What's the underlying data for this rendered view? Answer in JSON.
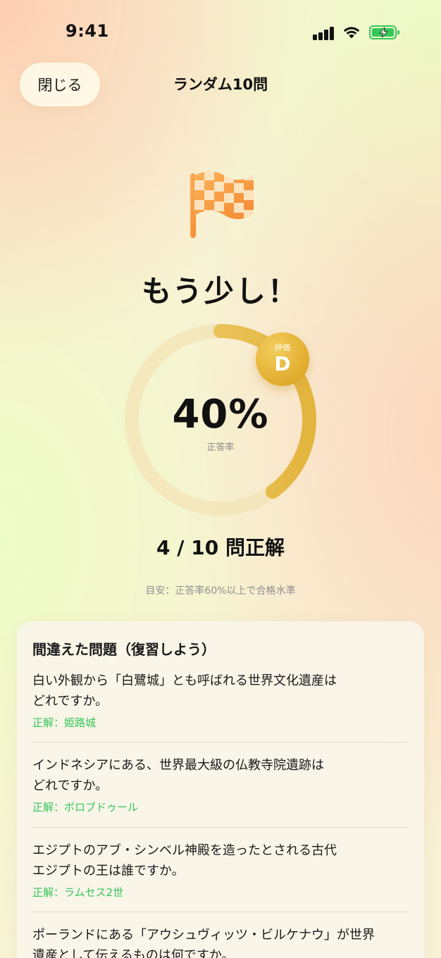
{
  "status_bar": {
    "time": "9:41"
  },
  "header": {
    "close_label": "閉じる",
    "title": "ランダム10問"
  },
  "result": {
    "headline": "もう少し！",
    "percent": "40%",
    "percent_label": "正答率",
    "accuracy_fraction": 0.4,
    "grade_label": "評価",
    "grade": "D",
    "score_text": "4 / 10 問正解",
    "hint": "目安：正答率60%以上で合格水準"
  },
  "wrong_questions": {
    "title": "間違えた問題（復習しよう）",
    "items": [
      {
        "line1": "白い外観から「白鷺城」とも呼ばれる世界文化遺産は",
        "line2": "どれですか。",
        "answer": "正解：姫路城"
      },
      {
        "line1": "インドネシアにある、世界最大級の仏教寺院遺跡は",
        "line2": "どれですか。",
        "answer": "正解：ボロブドゥール"
      },
      {
        "line1": "エジプトのアブ・シンベル神殿を造ったとされる古代",
        "line2": "エジプトの王は誰ですか。",
        "answer": "正解：ラムセス2世"
      },
      {
        "line1": "ポーランドにある「アウシュヴィッツ・ビルケナウ」が世界",
        "line2": "遺産として伝えるものは何ですか。"
      }
    ]
  },
  "colors": {
    "accent_gold": "#e8b73a",
    "ring_track": "#f3e3b0",
    "correct_green": "#34c759",
    "flag_orange": "#f7923a"
  },
  "icons": [
    "signal-icon",
    "wifi-icon",
    "battery-charging-icon",
    "checkered-flag-icon"
  ]
}
